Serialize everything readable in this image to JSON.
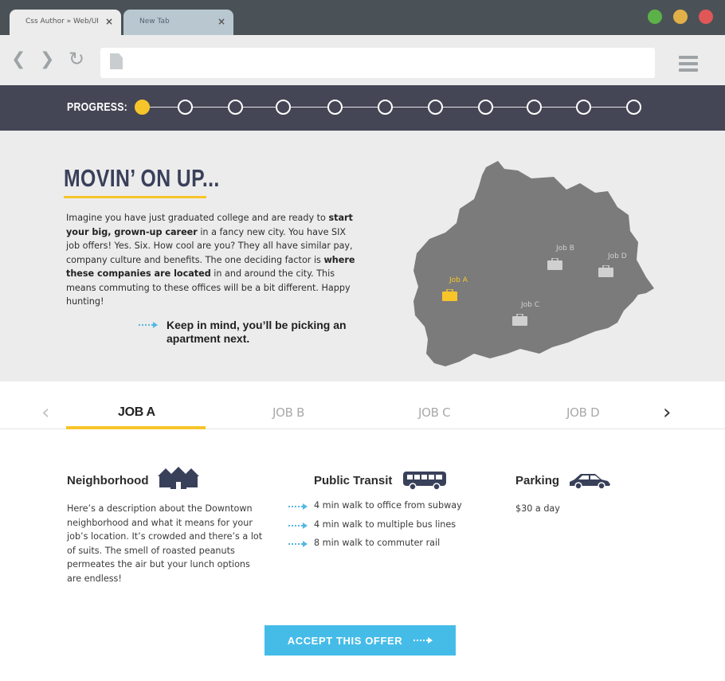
{
  "browser": {
    "tabs": [
      {
        "label": "Css Author » Web/UI",
        "close": "×"
      },
      {
        "label": "New Tab",
        "close": "×"
      }
    ],
    "window_buttons": [
      {
        "name": "maximize",
        "color": "#5cb248"
      },
      {
        "name": "minimize",
        "color": "#e2b048"
      },
      {
        "name": "close",
        "color": "#e05757"
      }
    ],
    "nav": {
      "back": "❮",
      "forward": "❯",
      "reload": "↻"
    }
  },
  "progress": {
    "label": "PROGRESS:",
    "total_steps": 11,
    "current_step": 1,
    "active_color": "#f7c52a"
  },
  "hero": {
    "title": "MOVIN’ ON UP...",
    "intro": {
      "p1": "Imagine you have just graduated college and are ready to ",
      "b1": "start your big, grown-up career",
      "p2": " in a fancy new city. You have SIX job offers! Yes. Six. How cool are you? They all have similar pay, company culture and benefits. The one deciding factor is ",
      "b2": "where these companies are located",
      "p3": " in and around the city. This means commuting to these offices will be a bit different. Happy hunting!"
    },
    "note": "Keep in mind, you’ll be picking an apartment next.",
    "map": {
      "jobs": [
        {
          "label": "Job A",
          "selected": true
        },
        {
          "label": "Job B",
          "selected": false
        },
        {
          "label": "Job C",
          "selected": false
        },
        {
          "label": "Job D",
          "selected": false
        }
      ]
    }
  },
  "job_tabs": {
    "prev": "‹",
    "next": "›",
    "tabs": [
      "JOB A",
      "JOB B",
      "JOB C",
      "JOB D"
    ],
    "active_index": 0
  },
  "details": {
    "neighborhood": {
      "heading": "Neighborhood",
      "text": "Here’s a description about the Downtown neighborhood and what it means for your job’s location. It’s crowded and there’s a lot of suits. The smell of roasted peanuts permeates the air but your lunch options are endless!"
    },
    "transit": {
      "heading": "Public Transit",
      "items": [
        "4 min walk to office from subway",
        "4 min walk to multiple bus lines",
        "8 min walk to commuter rail"
      ]
    },
    "parking": {
      "heading": "Parking",
      "text": "$30 a day"
    }
  },
  "cta": {
    "label": "ACCEPT THIS OFFER"
  }
}
